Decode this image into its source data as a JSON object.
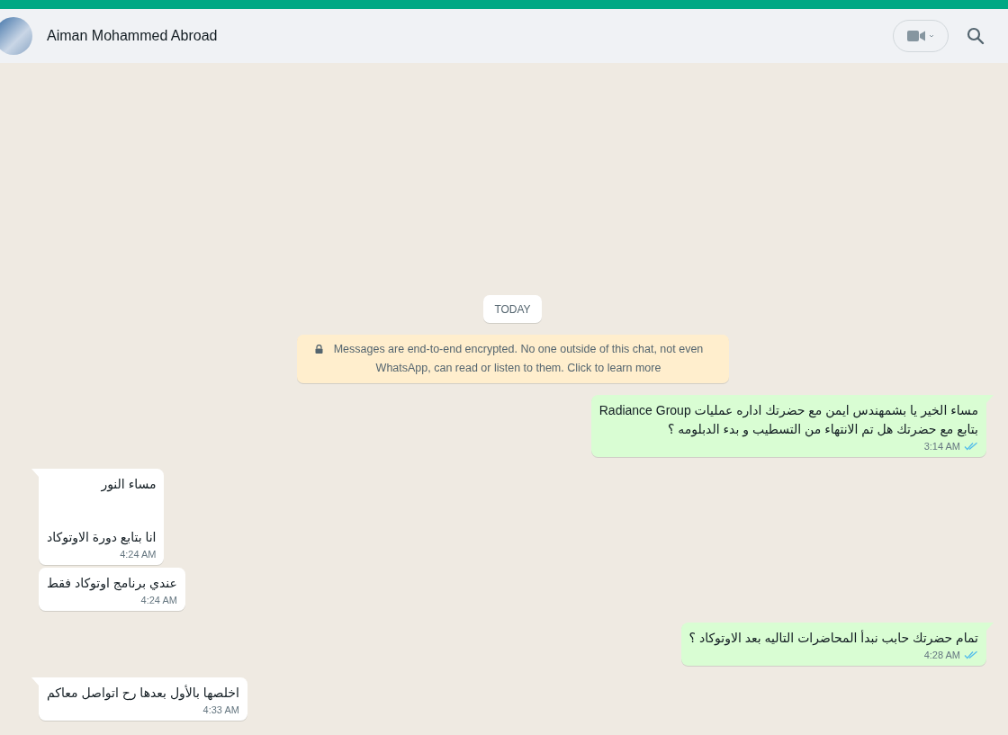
{
  "header": {
    "contact_name": "Aiman Mohammed Abroad"
  },
  "date_divider": "TODAY",
  "encryption_notice": "Messages are end-to-end encrypted. No one outside of this chat, not even WhatsApp, can read or listen to them. Click to learn more",
  "messages": [
    {
      "kind": "outgoing",
      "tail": true,
      "lines": [
        "مساء الخير يا بشمهندس ايمن مع  حضرتك اداره عمليات Radiance Group",
        "بتابع مع حضرتك هل تم الانتهاء من التسطيب و بدء الدبلومه ؟"
      ],
      "time": "3:14 AM",
      "read": true
    },
    {
      "kind": "incoming",
      "tail": true,
      "spaced": true,
      "lines": [
        "مساء النور",
        "انا بتابع دورة الاوتوكاد"
      ],
      "time": "4:24 AM"
    },
    {
      "kind": "incoming",
      "tail": false,
      "lines": [
        "عندي برنامج اوتوكاد فقط"
      ],
      "time": "4:24 AM"
    },
    {
      "kind": "outgoing",
      "tail": true,
      "lines": [
        "تمام حضرتك حابب نبدأ المحاضرات التاليه بعد الاوتوكاد ؟"
      ],
      "time": "4:28 AM",
      "read": true
    },
    {
      "kind": "incoming",
      "tail": true,
      "lines": [
        "اخلصها بالأول بعدها رح اتواصل معاكم"
      ],
      "time": "4:33 AM"
    }
  ]
}
